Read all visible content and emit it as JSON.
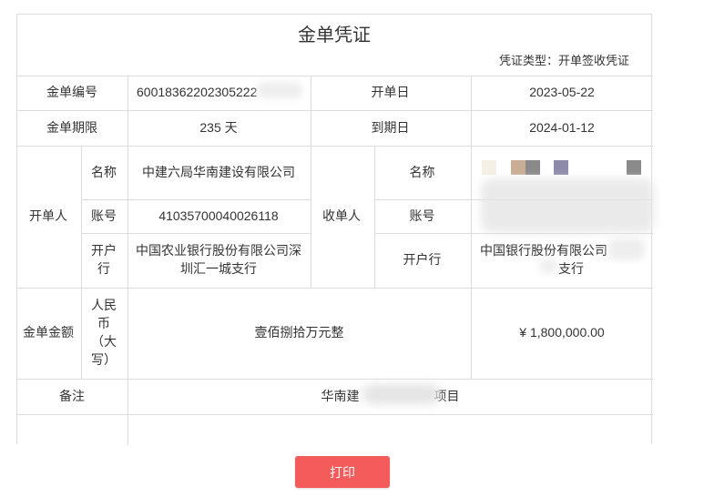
{
  "voucher": {
    "title": "金单凭证",
    "type_label": "凭证类型：开单签收凭证"
  },
  "labels": {
    "number": "金单编号",
    "issue_date": "开单日",
    "term": "金单期限",
    "due_date": "到期日",
    "issuer": "开单人",
    "receiver": "收单人",
    "name": "名称",
    "account": "账号",
    "bank": "开户行",
    "amount": "金单金额",
    "rmb_upper": "人民币（大写）",
    "remark": "备注"
  },
  "values": {
    "number": "60018362202305222",
    "issue_date": "2023-05-22",
    "term": "235 天",
    "due_date": "2024-01-12",
    "issuer_name": "中建六局华南建设有限公司",
    "issuer_account": "41035700040026118",
    "issuer_bank": "中国农业银行股份有限公司深圳汇一城支行",
    "receiver_name": "",
    "receiver_account": "",
    "receiver_bank_line1": "中国银行股份有限公司",
    "receiver_bank_line2": "支行",
    "amount_upper": "壹佰捌拾万元整",
    "amount_number": "¥ 1,800,000.00",
    "remark_prefix": "华南建",
    "remark_suffix": "项目"
  },
  "actions": {
    "print_label": "打印"
  },
  "colors": {
    "border": "#dcdcdc",
    "print_button": "#f45b5b"
  }
}
